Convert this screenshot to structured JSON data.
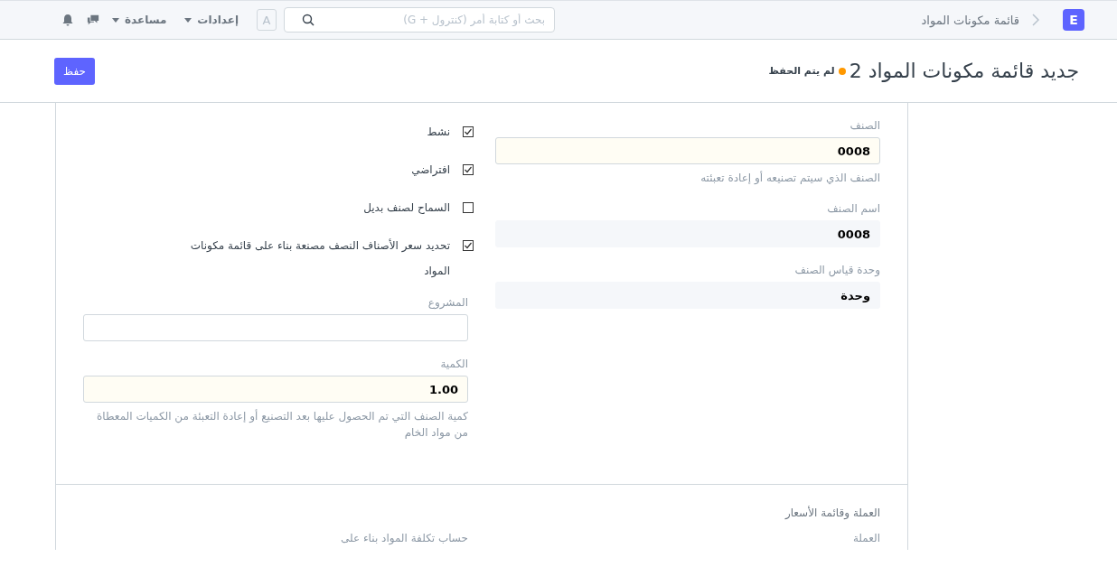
{
  "navbar": {
    "logo": "E",
    "breadcrumb": "قائمة مكونات المواد",
    "search": {
      "placeholder": "بحث أو كتابة أمر (كنترول + G)"
    },
    "avatar": "A",
    "menus": [
      "إعدادات",
      "مساعدة"
    ]
  },
  "page_header": {
    "title": "جديد قائمة مكونات المواد 2",
    "indicator": {
      "label": "لم يتم الحفظ",
      "color": "#ff9800"
    },
    "primary_button": "حفظ"
  },
  "form": {
    "right_column": [
      {
        "label": "الصنف",
        "value": "0008",
        "kind": "mandatory",
        "description": "الصنف الذي سيتم تصنيعه أو إعادة تعبئته"
      },
      {
        "label": "اسم الصنف",
        "value": "0008",
        "kind": "readonly"
      },
      {
        "label": "وحدة قياس الصنف",
        "value": "وحدة",
        "kind": "readonly"
      }
    ],
    "checkboxes": [
      {
        "label": "نشط",
        "checked": true
      },
      {
        "label": "افتراضي",
        "checked": true
      },
      {
        "label": "السماح لصنف بديل",
        "checked": false
      },
      {
        "label": "تحديد سعر الأصناف النصف مصنعة بناء على قائمة مكونات المواد",
        "checked": true
      }
    ],
    "left_fields": [
      {
        "label": "المشروع",
        "kind": "input"
      },
      {
        "label": "الكمية",
        "value": "1.00",
        "kind": "mandatory",
        "description": "كمية الصنف التي تم الحصول عليها بعد التصنيع أو إعادة التعبئة من الكميات المعطاة من مواد الخام"
      }
    ]
  },
  "currency_section": {
    "heading": "العملة وقائمة الأسعار",
    "right_label": "العملة",
    "left_label": "حساب تكلفة المواد بناء على"
  }
}
